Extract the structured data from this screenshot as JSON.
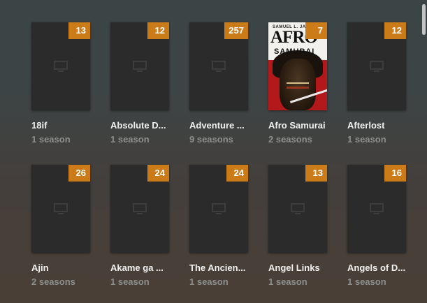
{
  "library": {
    "items": [
      {
        "title": "18if",
        "subtitle": "1 season",
        "count": "13",
        "has_art": false
      },
      {
        "title": "Absolute D...",
        "subtitle": "1 season",
        "count": "12",
        "has_art": false
      },
      {
        "title": "Adventure ...",
        "subtitle": "9 seasons",
        "count": "257",
        "has_art": false
      },
      {
        "title": "Afro Samurai",
        "subtitle": "2 seasons",
        "count": "7",
        "has_art": true,
        "art": {
          "actor": "SAMUEL L. JACKSON",
          "logo": "AFRO",
          "logo_sub": "SAMURAI"
        }
      },
      {
        "title": "Afterlost",
        "subtitle": "1 season",
        "count": "12",
        "has_art": false
      },
      {
        "title": "Ajin",
        "subtitle": "2 seasons",
        "count": "26",
        "has_art": false
      },
      {
        "title": "Akame ga ...",
        "subtitle": "1 season",
        "count": "24",
        "has_art": false
      },
      {
        "title": "The Ancien...",
        "subtitle": "1 season",
        "count": "24",
        "has_art": false
      },
      {
        "title": "Angel Links",
        "subtitle": "1 season",
        "count": "13",
        "has_art": false
      },
      {
        "title": "Angels of D...",
        "subtitle": "1 season",
        "count": "16",
        "has_art": false
      }
    ]
  },
  "colors": {
    "badge": "#cc7b19",
    "placeholder": "#2a2b2a"
  },
  "icons": {
    "placeholder": "tv-icon"
  }
}
